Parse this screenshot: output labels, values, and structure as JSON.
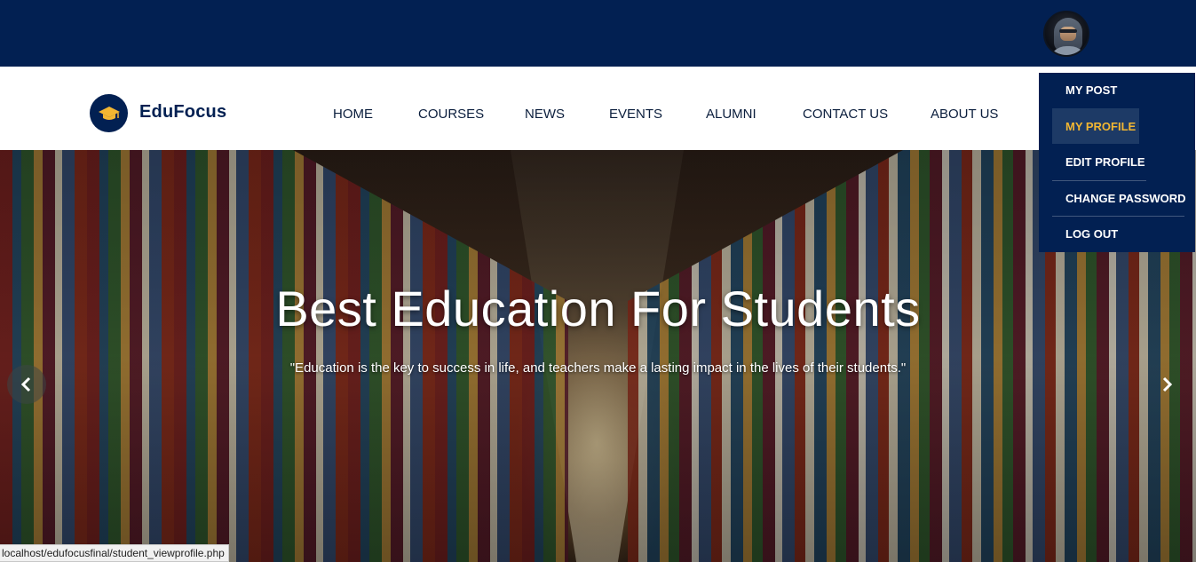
{
  "header": {
    "avatar_icon": "user-avatar-icon",
    "brand_color": "#022052"
  },
  "nav": {
    "logo_icon": "graduation-cap-icon",
    "logo_text": "EduFocus",
    "items": [
      {
        "label": "HOME"
      },
      {
        "label": "COURSES"
      },
      {
        "label": "NEWS"
      },
      {
        "label": "EVENTS"
      },
      {
        "label": "ALUMNI"
      },
      {
        "label": "CONTACT US"
      },
      {
        "label": "ABOUT US"
      }
    ]
  },
  "user_menu": {
    "items": [
      {
        "label": "MY POST"
      },
      {
        "label": "MY PROFILE",
        "active": true
      },
      {
        "label": "EDIT PROFILE"
      },
      {
        "label": "CHANGE PASSWORD"
      },
      {
        "label": "LOG OUT"
      }
    ],
    "active_color": "#f2b632"
  },
  "hero": {
    "title": "Best Education For Students",
    "quote": "\"Education is the key to success in life, and teachers make a lasting impact in the lives of their students.\"",
    "prev_icon": "chevron-left-icon",
    "next_icon": "chevron-right-icon"
  },
  "status_bar": {
    "url": "localhost/edufocusfinal/student_viewprofile.php"
  }
}
